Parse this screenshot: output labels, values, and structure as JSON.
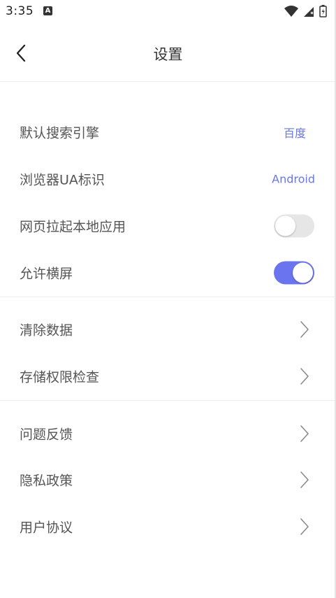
{
  "status_bar": {
    "time": "3:35",
    "notification_badge": "A"
  },
  "header": {
    "title": "设置"
  },
  "sections": {
    "browser": {
      "search_engine": {
        "label": "默认搜索引擎",
        "value": "百度"
      },
      "user_agent": {
        "label": "浏览器UA标识",
        "value": "Android"
      },
      "open_native_apps": {
        "label": "网页拉起本地应用",
        "enabled": false
      },
      "allow_landscape": {
        "label": "允许横屏",
        "enabled": true
      }
    },
    "data": {
      "clear_data": {
        "label": "清除数据"
      },
      "storage_permission": {
        "label": "存储权限检查"
      }
    },
    "about": {
      "feedback": {
        "label": "问题反馈"
      },
      "privacy_policy": {
        "label": "隐私政策"
      },
      "user_agreement": {
        "label": "用户协议"
      }
    }
  },
  "colors": {
    "accent": "#6a74ee",
    "value_text": "#6a76e8",
    "label_text": "#555555",
    "toggle_off": "#e6e6e6"
  }
}
